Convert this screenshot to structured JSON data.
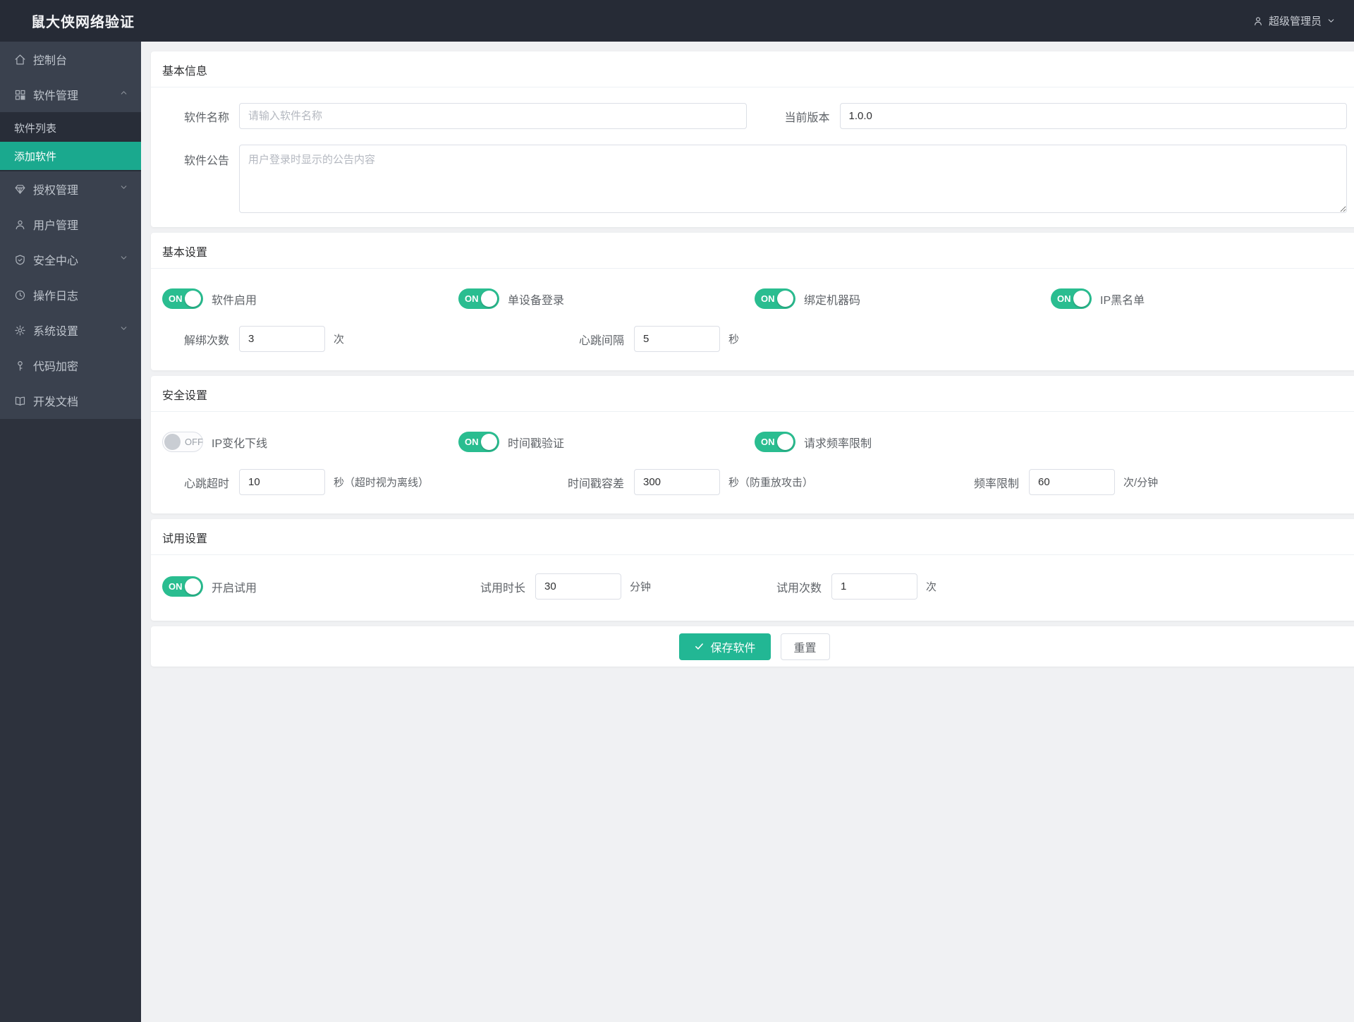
{
  "header": {
    "title": "鼠大侠网络验证",
    "user": "超级管理员"
  },
  "sidebar": {
    "items": [
      {
        "label": "控制台"
      },
      {
        "label": "软件管理"
      },
      {
        "label": "软件列表"
      },
      {
        "label": "添加软件"
      },
      {
        "label": "授权管理"
      },
      {
        "label": "用户管理"
      },
      {
        "label": "安全中心"
      },
      {
        "label": "操作日志"
      },
      {
        "label": "系统设置"
      },
      {
        "label": "代码加密"
      },
      {
        "label": "开发文档"
      }
    ]
  },
  "basic_info": {
    "title": "基本信息",
    "name_label": "软件名称",
    "name_placeholder": "请输入软件名称",
    "version_label": "当前版本",
    "version_value": "1.0.0",
    "notice_label": "软件公告",
    "notice_placeholder": "用户登录时显示的公告内容"
  },
  "basic_settings": {
    "title": "基本设置",
    "toggles": [
      {
        "label": "软件启用",
        "state": "ON"
      },
      {
        "label": "单设备登录",
        "state": "ON"
      },
      {
        "label": "绑定机器码",
        "state": "ON"
      },
      {
        "label": "IP黑名单",
        "state": "ON"
      }
    ],
    "unbind_label": "解绑次数",
    "unbind_value": "3",
    "unbind_unit": "次",
    "heartbeat_label": "心跳间隔",
    "heartbeat_value": "5",
    "heartbeat_unit": "秒"
  },
  "security_settings": {
    "title": "安全设置",
    "toggles": [
      {
        "label": "IP变化下线",
        "state": "OFF"
      },
      {
        "label": "时间戳验证",
        "state": "ON"
      },
      {
        "label": "请求频率限制",
        "state": "ON"
      }
    ],
    "timeout_label": "心跳超时",
    "timeout_value": "10",
    "timeout_unit": "秒（超时视为离线）",
    "tolerance_label": "时间戳容差",
    "tolerance_value": "300",
    "tolerance_unit": "秒（防重放攻击）",
    "rate_label": "频率限制",
    "rate_value": "60",
    "rate_unit": "次/分钟"
  },
  "trial_settings": {
    "title": "试用设置",
    "toggle": {
      "label": "开启试用",
      "state": "ON"
    },
    "duration_label": "试用时长",
    "duration_value": "30",
    "duration_unit": "分钟",
    "count_label": "试用次数",
    "count_value": "1",
    "count_unit": "次"
  },
  "actions": {
    "save": "保存软件",
    "reset": "重置"
  },
  "colors": {
    "accent": "#22b794",
    "sidebar_active": "#1aa98e",
    "toggle_on": "#2abd90",
    "header_bg": "#262b36",
    "sidebar_bg": "#3a414e"
  }
}
